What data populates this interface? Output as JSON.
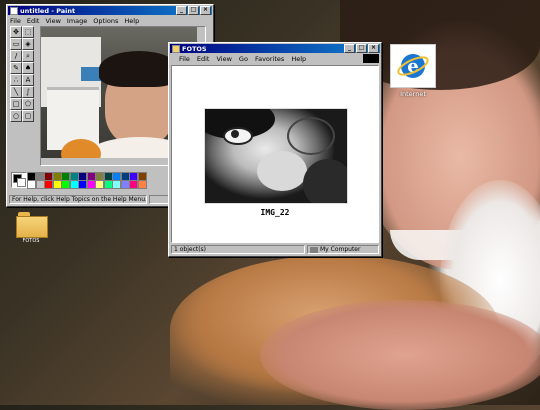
{
  "paint_window": {
    "title": "untitled - Paint",
    "menu": [
      "File",
      "Edit",
      "View",
      "Image",
      "Options",
      "Help"
    ],
    "status": "For Help, click Help Topics on the Help Menu.",
    "palette": [
      "#000000",
      "#808080",
      "#800000",
      "#808000",
      "#008000",
      "#008080",
      "#000080",
      "#800080",
      "#808040",
      "#004040",
      "#0080ff",
      "#004080",
      "#4000ff",
      "#804000",
      "#ffffff",
      "#c0c0c0",
      "#ff0000",
      "#ffff00",
      "#00ff00",
      "#00ffff",
      "#0000ff",
      "#ff00ff",
      "#ffff80",
      "#00ff80",
      "#80ffff",
      "#8080ff",
      "#ff0080",
      "#ff8040"
    ]
  },
  "explorer_window": {
    "title": "FOTOS",
    "menu": [
      "File",
      "Edit",
      "View",
      "Go",
      "Favorites",
      "Help"
    ],
    "file_label": "IMG_22",
    "status_left": "1 object(s)",
    "status_right": "My Computer"
  },
  "desktop": {
    "folder_label": "FOTOS",
    "ie_label": "Internet",
    "ie_icon": "internet-explorer-icon",
    "folder_icon": "folder-icon"
  }
}
